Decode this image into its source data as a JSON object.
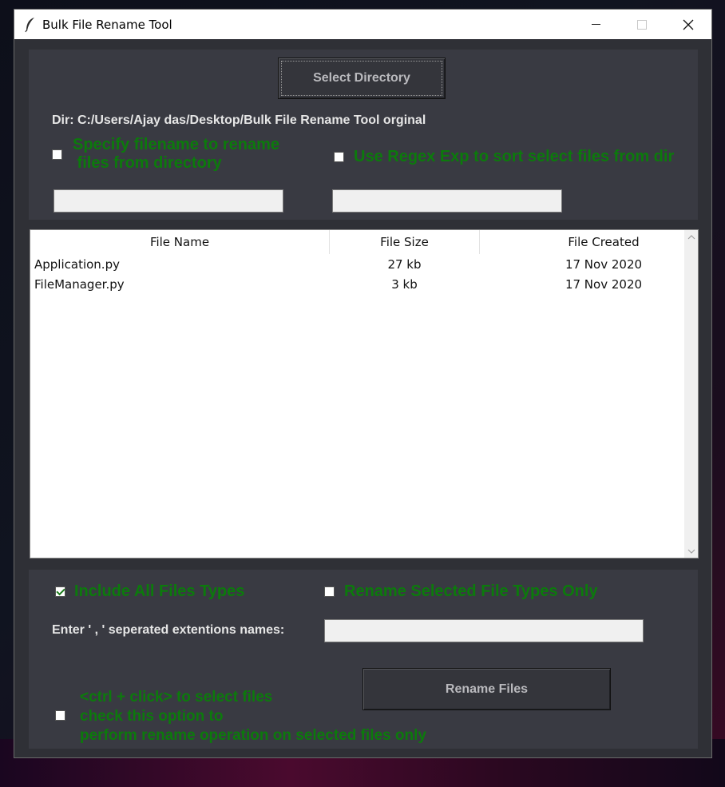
{
  "window": {
    "title": "Bulk File Rename Tool",
    "minimize": "minimize",
    "maximize": "maximize",
    "close": "✕"
  },
  "top": {
    "select_directory_label": "Select Directory",
    "dir_label": "Dir:  C:/Users/Ajay das/Desktop/Bulk File Rename Tool orginal",
    "specify_filename_label": "Specify filename to rename\n files from directory",
    "specify_filename_checked": false,
    "specify_filename_value": "",
    "regex_label": "Use Regex Exp to sort select files from dir",
    "regex_checked": false,
    "regex_value": ""
  },
  "table": {
    "columns": [
      "File Name",
      "File Size",
      "File Created"
    ],
    "rows": [
      [
        "Application.py",
        "27 kb",
        "17 Nov 2020"
      ],
      [
        "FileManager.py",
        "3 kb",
        "17 Nov 2020"
      ]
    ]
  },
  "bottom": {
    "include_all_label": "Include All Files Types",
    "include_all_checked": true,
    "rename_selected_types_label": "Rename Selected File Types Only",
    "rename_selected_types_checked": false,
    "extensions_label": "Enter ' , ' seperated extentions names:",
    "extensions_value": "",
    "rename_button_label": "Rename Files",
    "ctrl_click_label": "<ctrl + click> to select files\ncheck this option to\nperform rename operation on selected files only",
    "ctrl_click_checked": false
  },
  "icons": {
    "app": "feather-icon",
    "scroll_up": "chevron-up-icon",
    "scroll_down": "chevron-down-icon"
  }
}
